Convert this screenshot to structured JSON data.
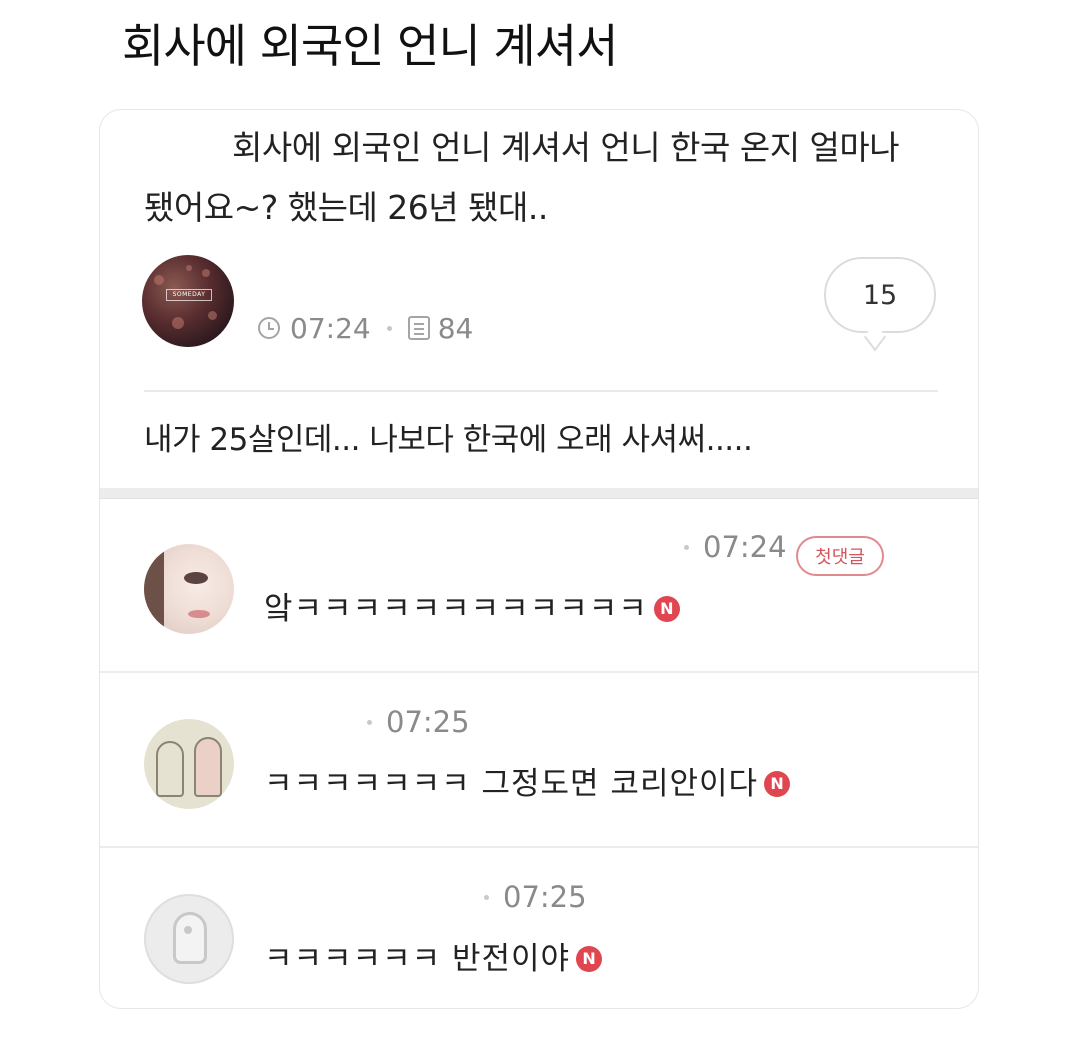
{
  "page": {
    "title": "회사에 외국인 언니 계셔서"
  },
  "post": {
    "body": "회사에 외국인 언니 계셔서 언니 한국 온지 얼마나 됐어요~? 했는데 26년 됐대..",
    "avatar_tag": "SOMEDAY",
    "time": "07:24",
    "views": "84",
    "comment_count": "15",
    "footer_text": "내가 25살인데... 나보다 한국에 오래 사셔써....."
  },
  "comments": [
    {
      "time": "07:24",
      "badge": "첫댓글",
      "text": "앜ㅋㅋㅋㅋㅋㅋㅋㅋㅋㅋㅋㅋ",
      "new_label": "N"
    },
    {
      "time": "07:25",
      "text": "ㅋㅋㅋㅋㅋㅋㅋ 그정도면 코리안이다",
      "new_label": "N"
    },
    {
      "time": "07:25",
      "text": "ㅋㅋㅋㅋㅋㅋ 반전이야",
      "new_label": "N"
    }
  ],
  "colors": {
    "new_badge": "#e0464f",
    "first_comment_badge": "#d4555d",
    "meta_text": "#8a8a8a"
  },
  "icons": {
    "clock": "clock-icon",
    "views": "document-icon",
    "comments": "speech-bubble-icon",
    "new": "new-n-icon"
  }
}
